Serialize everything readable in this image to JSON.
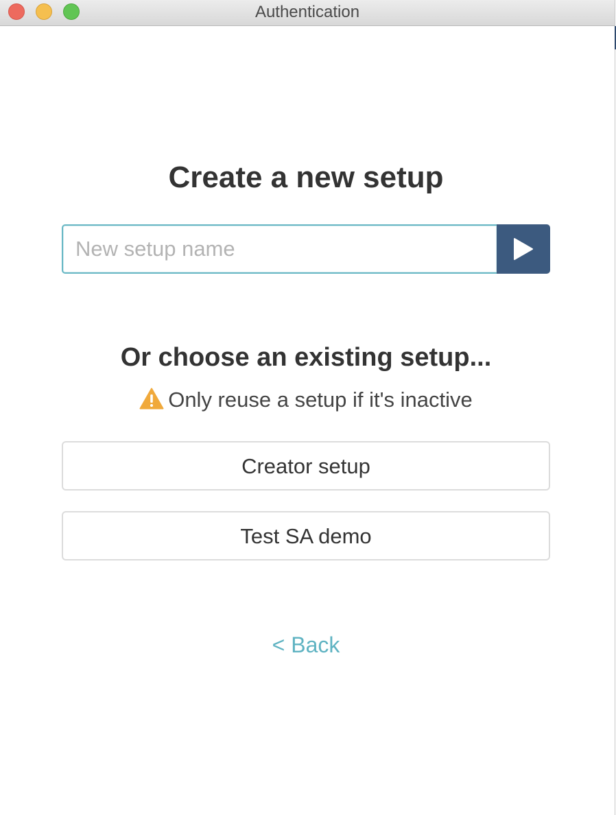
{
  "window": {
    "title": "Authentication"
  },
  "create": {
    "heading": "Create a new setup",
    "input_placeholder": "New setup name",
    "input_value": "",
    "submit_icon": "play-triangle-icon"
  },
  "existing": {
    "heading": "Or choose an existing setup...",
    "warning_icon": "warning-triangle-icon",
    "warning_text": "Only reuse a setup if it's inactive",
    "setups": [
      {
        "label": "Creator setup"
      },
      {
        "label": "Test SA demo"
      }
    ]
  },
  "navigation": {
    "back_label": "< Back"
  },
  "colors": {
    "accent_dark_blue": "#3c5a7f",
    "input_focus": "#67b7c4",
    "link": "#5fb3c2",
    "warning": "#f0a93b",
    "heading_text": "#333333"
  }
}
